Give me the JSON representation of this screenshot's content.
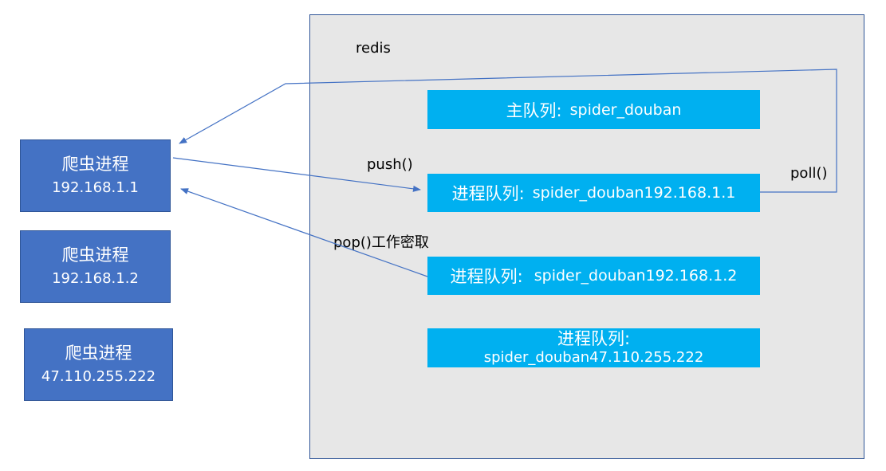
{
  "redis": {
    "label": "redis"
  },
  "processes": [
    {
      "title": "爬虫进程",
      "ip": "192.168.1.1"
    },
    {
      "title": "爬虫进程",
      "ip": "192.168.1.2"
    },
    {
      "title": "爬虫进程",
      "ip": "47.110.255.222"
    }
  ],
  "queues": {
    "main": {
      "prefix": "主队列:",
      "name": "spider_douban"
    },
    "q1": {
      "prefix": "进程队列:",
      "name": "spider_douban192.168.1.1"
    },
    "q2": {
      "prefix": "进程队列:",
      "name": "spider_douban192.168.1.2"
    },
    "q3": {
      "prefix": "进程队列:",
      "name": "spider_douban47.110.255.222"
    }
  },
  "edges": {
    "push": "push()",
    "poll": "poll()",
    "pop": "pop()工作密取"
  },
  "colors": {
    "process_fill": "#4472c4",
    "queue_fill": "#00b0f0",
    "redis_fill": "#e7e7e7",
    "line": "#4472c4"
  }
}
